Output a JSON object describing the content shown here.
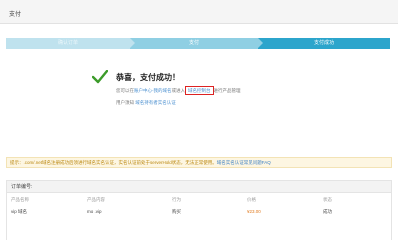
{
  "header": {
    "title": "支付"
  },
  "steps": [
    {
      "label": "确认订单"
    },
    {
      "label": "支付"
    },
    {
      "label": "支付成功"
    }
  ],
  "result": {
    "title": "恭喜，支付成功！",
    "line1_prefix": "您可以在",
    "line1_link": "账户中心-我的域名",
    "line1_middle": "或进入",
    "line1_boxed": "域名控制台",
    "line1_suffix": "进行产品管理",
    "line2_prefix": "用户须知",
    "line2_link": "域名持有者实名认证"
  },
  "tip": {
    "text": "提示：.com/.net域名注册成功后须进行域名实名认证，实名认证前处于serverHold状态，无法正常使用。",
    "link": "域名实名认证常见问题FAQ"
  },
  "order": {
    "title": "订单编号:",
    "columns": [
      "产品名称",
      "产品内容",
      "行为",
      "价格",
      "状态"
    ],
    "rows": [
      {
        "name": "vip 域名",
        "content": "mo    .vip",
        "action": "购买",
        "price": "¥23.00",
        "status": "成功"
      }
    ]
  },
  "colors": {
    "step_active": "#2ca5cc",
    "step_done": "#8fcfe3",
    "check": "#3c9b2a",
    "price": "#e07a1f"
  }
}
